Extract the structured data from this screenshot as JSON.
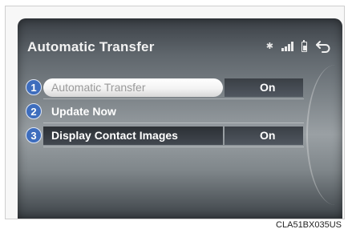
{
  "header": {
    "title": "Automatic Transfer"
  },
  "status_icons": [
    "bluetooth-icon",
    "signal-icon",
    "battery-icon",
    "back-icon"
  ],
  "menu": {
    "items": [
      {
        "number": "1",
        "label": "Automatic Transfer",
        "value": "On"
      },
      {
        "number": "2",
        "label": "Update Now",
        "value": ""
      },
      {
        "number": "3",
        "label": "Display Contact Images",
        "value": "On"
      }
    ]
  },
  "figure_code": "CLA51BX035US",
  "colors": {
    "badge": "#3e6dbd",
    "screen_bg": "#7b8287"
  }
}
